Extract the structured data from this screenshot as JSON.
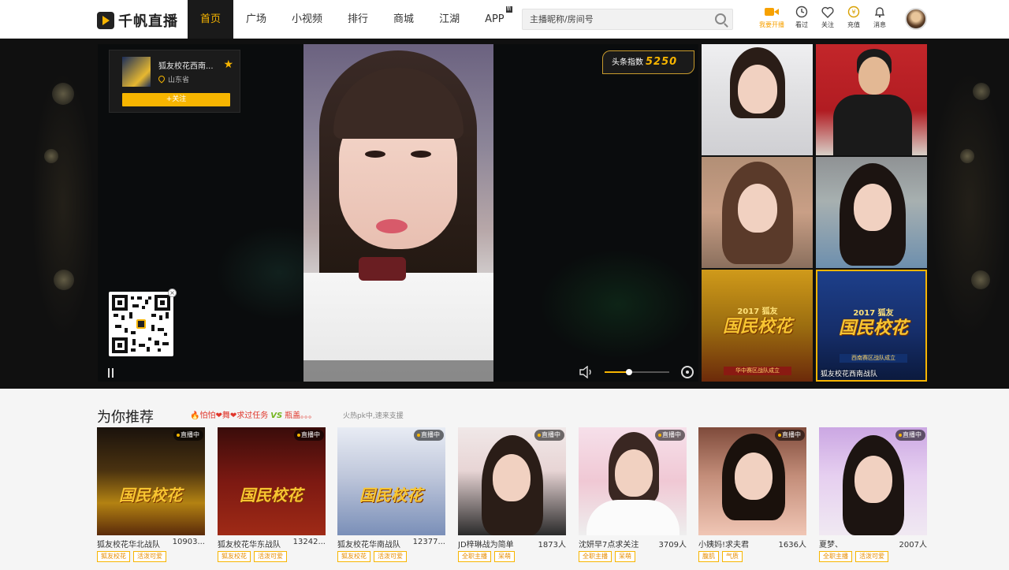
{
  "header": {
    "logo_text": "千帆直播",
    "nav": [
      {
        "label": "首页",
        "active": true
      },
      {
        "label": "广场"
      },
      {
        "label": "小视频"
      },
      {
        "label": "排行"
      },
      {
        "label": "商城"
      },
      {
        "label": "江湖"
      },
      {
        "label": "APP",
        "badge": "新"
      }
    ],
    "search": {
      "placeholder": "主播昵称/房间号"
    },
    "tools": [
      {
        "label": "我要开播",
        "icon": "camera-icon"
      },
      {
        "label": "看过",
        "icon": "clock-icon"
      },
      {
        "label": "关注",
        "icon": "heart-icon"
      },
      {
        "label": "充值",
        "icon": "coin-icon"
      },
      {
        "label": "消息",
        "icon": "bell-icon"
      }
    ],
    "avatar_icon": "user-avatar"
  },
  "stage": {
    "host": {
      "name": "狐友校花西南...",
      "location": "山东省",
      "follow_label": "+关注",
      "badge_icon": "star-icon"
    },
    "hot_index": {
      "label": "头条指数",
      "value": "5250"
    },
    "qr_close": "×",
    "volume_level": 0.38,
    "thumbs": [
      {
        "caption": ""
      },
      {
        "caption": ""
      },
      {
        "caption": ""
      },
      {
        "caption": ""
      },
      {
        "caption": "",
        "poster_sub": "2017 狐友",
        "poster_title": "国民校花",
        "poster_tag": "华中赛区战队成立"
      },
      {
        "caption": "狐友校花西南战队",
        "poster_sub": "2017 狐友",
        "poster_title": "国民校花",
        "poster_tag": "西南赛区战队成立"
      }
    ]
  },
  "rec": {
    "title": "为你推荐",
    "pk": {
      "left": "怕怕❤舞❤求过任务",
      "vs": "VS",
      "right": "瓶盖。。。"
    },
    "hint": "火热pk中,速来支援",
    "live_badge": "直播中",
    "cards": [
      {
        "name": "狐友校花华北战队",
        "count": "10903...",
        "tags": [
          "狐友校花",
          "活泼可爱"
        ],
        "poster_title": "国民校花"
      },
      {
        "name": "狐友校花华东战队",
        "count": "13242...",
        "tags": [
          "狐友校花",
          "活泼可爱"
        ],
        "poster_title": "国民校花"
      },
      {
        "name": "狐友校花华南战队",
        "count": "12377...",
        "tags": [
          "狐友校花",
          "活泼可爱"
        ],
        "poster_title": "国民校花"
      },
      {
        "name": "JD梓琳战为简单",
        "count": "1873人",
        "tags": [
          "全职主播",
          "呆萌"
        ],
        "poster_title": ""
      },
      {
        "name": "沈妍早7点求关注",
        "count": "3709人",
        "tags": [
          "全职主播",
          "呆萌"
        ],
        "poster_title": ""
      },
      {
        "name": "小姨妈!求夫君",
        "count": "1636人",
        "tags": [
          "腹肌",
          "气质"
        ],
        "poster_title": ""
      },
      {
        "name": "夏梦、",
        "count": "2007人",
        "tags": [
          "全职主播",
          "活泼可爱"
        ],
        "poster_title": ""
      }
    ]
  }
}
